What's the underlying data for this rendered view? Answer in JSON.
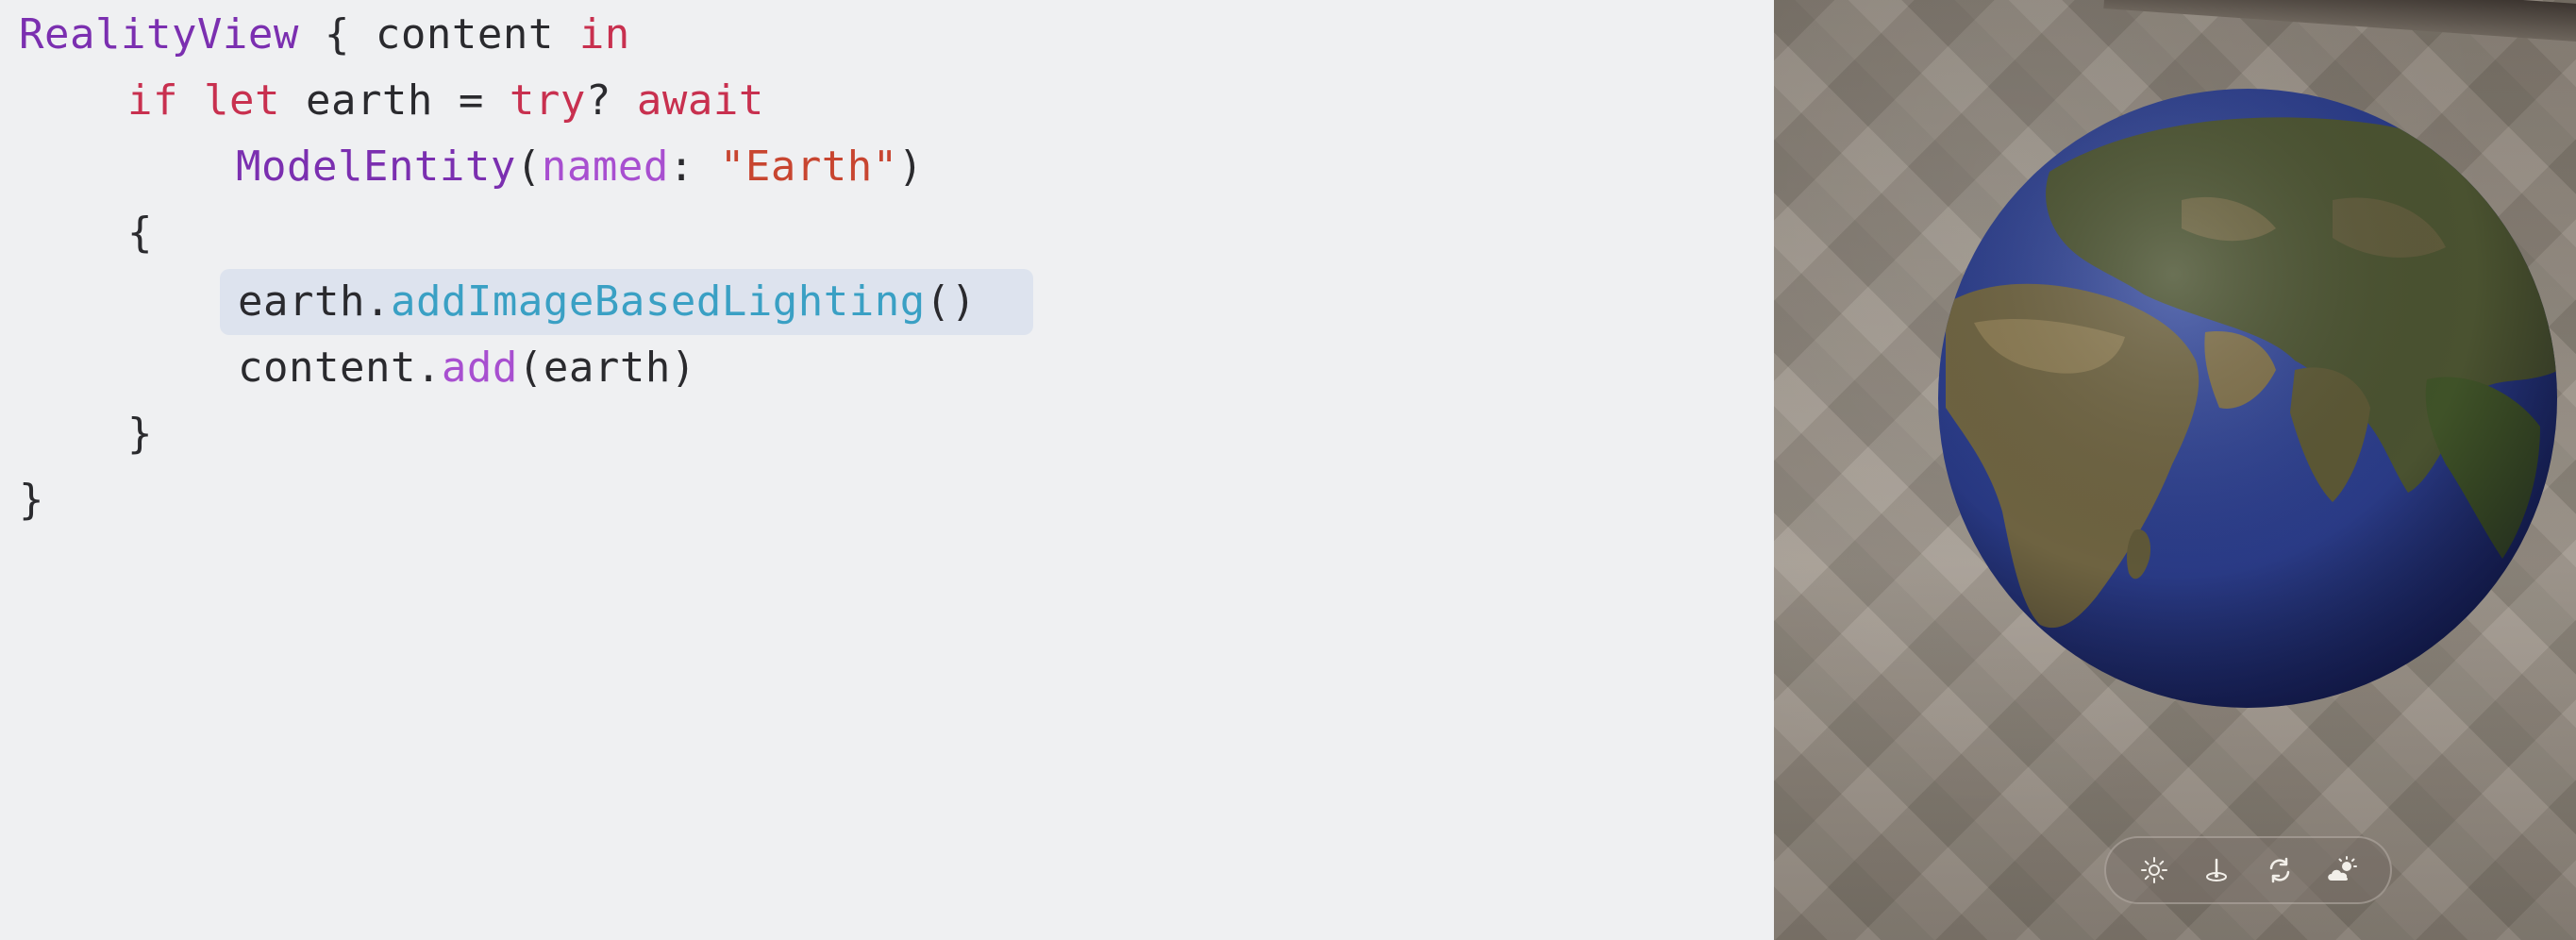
{
  "code": {
    "lines": [
      [
        "RealityView",
        " { content ",
        "in"
      ],
      [
        "if",
        " ",
        "let",
        " earth = ",
        "try",
        "? ",
        "await"
      ],
      [
        "ModelEntity",
        "(",
        "named",
        ": ",
        "\"Earth\"",
        ")"
      ],
      [
        "{"
      ],
      [
        "earth.",
        "addImageBasedLighting",
        "()"
      ],
      [
        "content.",
        "add",
        "(earth)"
      ],
      [
        "}"
      ],
      [
        "}"
      ]
    ],
    "highlighted_line": 4
  },
  "scene": {
    "model_name": "Earth",
    "toolbar": {
      "buttons": [
        "sun-icon",
        "anchor-icon",
        "rotate-icon",
        "weather-icon"
      ]
    }
  }
}
